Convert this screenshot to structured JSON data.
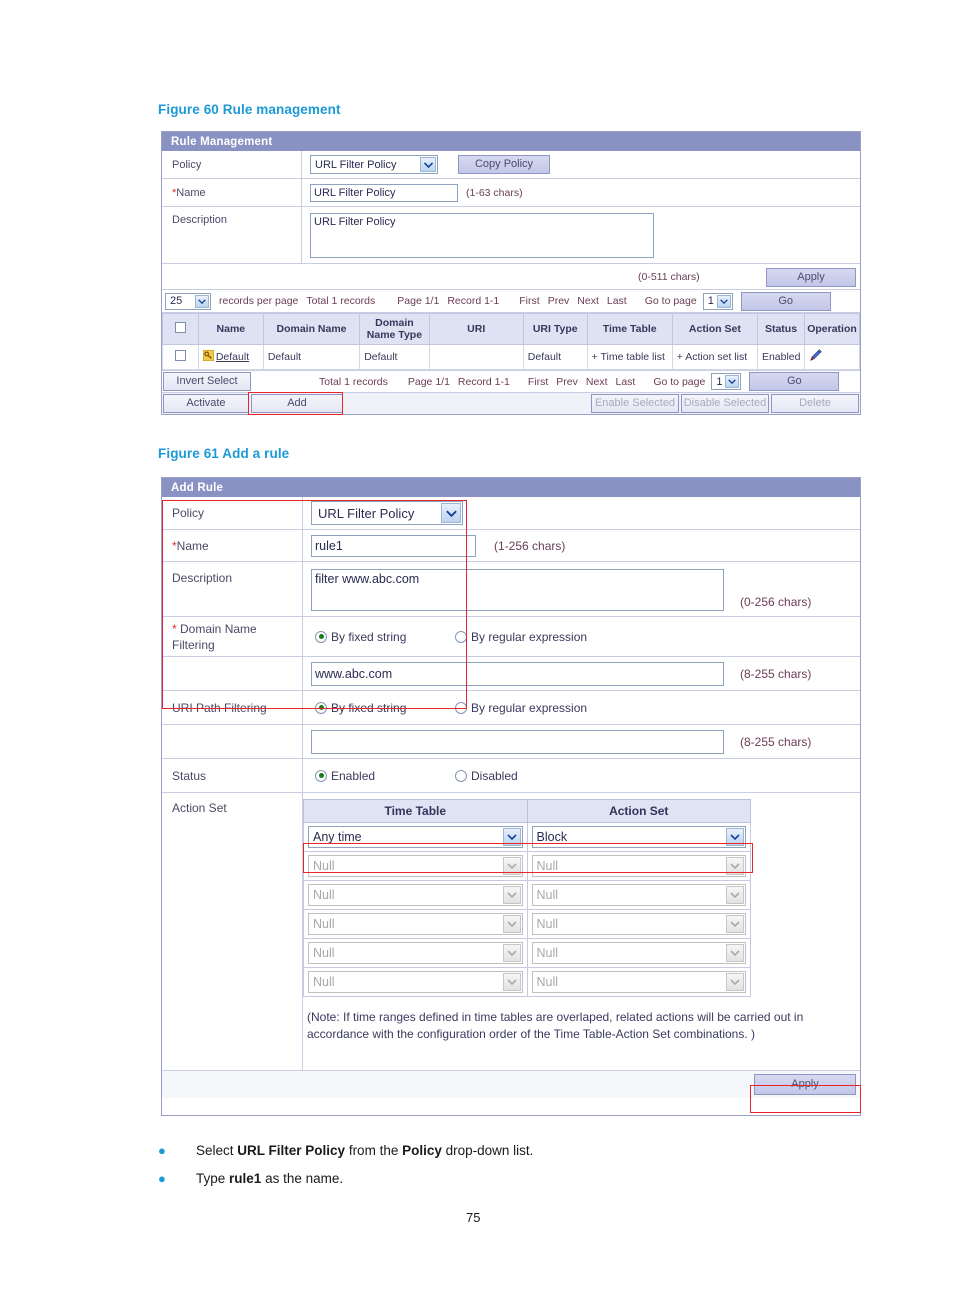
{
  "page": {
    "number": "75"
  },
  "figure60": {
    "caption": "Figure 60 Rule management",
    "panel_title": "Rule Management",
    "form": {
      "policy_label": "Policy",
      "policy_value": "URL Filter Policy",
      "copy_policy_button": "Copy Policy",
      "name_label": "Name",
      "name_value": "URL Filter Policy",
      "name_hint": "(1-63  chars)",
      "description_label": "Description",
      "description_value": "URL Filter Policy",
      "description_hint": "(0-511  chars)",
      "apply_button": "Apply"
    },
    "paging_top": {
      "per_page_value": "25",
      "per_page_text": "records per page",
      "total": "Total 1 records",
      "page": "Page 1/1",
      "record": "Record  1-1",
      "first": "First",
      "prev": "Prev",
      "next": "Next",
      "last": "Last",
      "goto": "Go to page",
      "goto_value": "1",
      "go_button": "Go"
    },
    "table": {
      "columns": [
        "",
        "Name",
        "Domain Name",
        "Domain Name Type",
        "URI",
        "URI Type",
        "Time Table",
        "Action Set",
        "Status",
        "Operation"
      ],
      "rows": [
        {
          "name": "Default",
          "domain_name": "Default",
          "domain_name_type": "Default",
          "uri": "",
          "uri_type": "Default",
          "time_table": "+ Time table list",
          "action_set": "+ Action set list",
          "status": "Enabled",
          "operation": "edit-icon"
        }
      ]
    },
    "paging_bottom": {
      "invert_select": "Invert Select",
      "total": "Total 1 records",
      "page": "Page 1/1",
      "record": "Record  1-1",
      "first": "First",
      "prev": "Prev",
      "next": "Next",
      "last": "Last",
      "goto": "Go to page",
      "goto_value": "1",
      "go_button": "Go"
    },
    "actions": {
      "activate": "Activate",
      "add": "Add",
      "enable_selected": "Enable Selected",
      "disable_selected": "Disable Selected",
      "delete": "Delete"
    }
  },
  "figure61": {
    "caption": "Figure 61 Add a rule",
    "panel_title": "Add Rule",
    "form": {
      "policy_label": "Policy",
      "policy_value": "URL Filter Policy",
      "name_label": "Name",
      "name_value": "rule1",
      "name_hint": "(1-256  chars)",
      "description_label": "Description",
      "description_value": "filter www.abc.com",
      "description_hint": "(0-256  chars)",
      "domain_filter_label": "Domain Name Filtering",
      "domain_fixed": "By fixed string",
      "domain_regex": "By regular expression",
      "domain_value": "www.abc.com",
      "domain_hint": "(8-255  chars)",
      "uri_filter_label": "URI Path Filtering",
      "uri_fixed": "By fixed string",
      "uri_regex": "By regular expression",
      "uri_value": "",
      "uri_hint": "(8-255  chars)",
      "status_label": "Status",
      "status_enabled": "Enabled",
      "status_disabled": "Disabled",
      "action_set_label": "Action Set",
      "apply_button": "Apply"
    },
    "action_table": {
      "headers": [
        "Time Table",
        "Action Set"
      ],
      "rows": [
        {
          "time_table": "Any time",
          "action_set": "Block",
          "enabled": true
        },
        {
          "time_table": "Null",
          "action_set": "Null",
          "enabled": false
        },
        {
          "time_table": "Null",
          "action_set": "Null",
          "enabled": false
        },
        {
          "time_table": "Null",
          "action_set": "Null",
          "enabled": false
        },
        {
          "time_table": "Null",
          "action_set": "Null",
          "enabled": false
        },
        {
          "time_table": "Null",
          "action_set": "Null",
          "enabled": false
        }
      ],
      "note": "(Note: If time ranges defined in time tables are overlaped, related actions will be carried out in accordance with the configuration order of the Time Table-Action Set combinations. )"
    }
  },
  "bullets": [
    {
      "pre": "Select ",
      "b1": "URL Filter Policy",
      "mid": " from the ",
      "b2": "Policy",
      "post": " drop-down list."
    },
    {
      "pre": "Type ",
      "b1": "rule1",
      "mid": "",
      "b2": "",
      "post": " as the name."
    }
  ],
  "colors": {
    "caption": "#1c9ad6",
    "panel_header": "#8a91c3",
    "highlight": "#e8262a"
  }
}
